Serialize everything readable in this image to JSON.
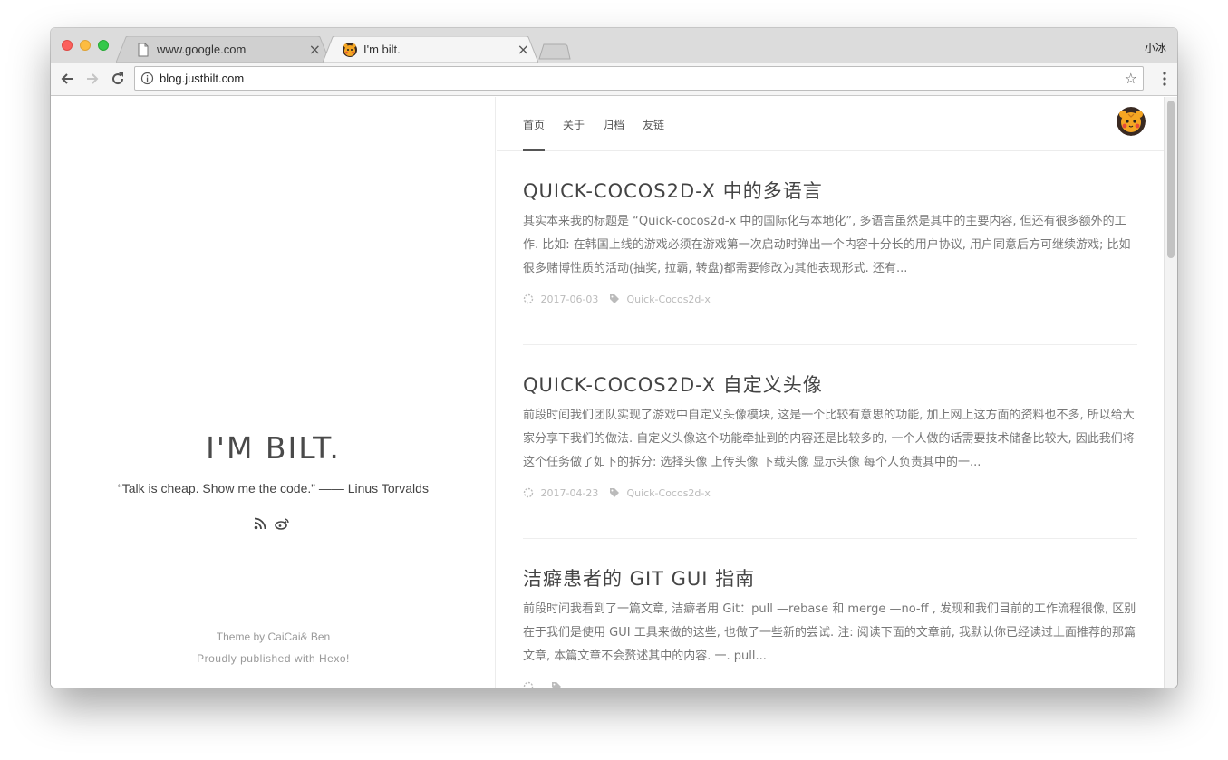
{
  "browser": {
    "tabs": [
      {
        "title": "www.google.com",
        "favicon": "page-icon",
        "active": false
      },
      {
        "title": "I'm bilt.",
        "favicon": "tiger-favicon",
        "active": true
      }
    ],
    "close_glyph": "×",
    "profile_name": "小冰",
    "url": "blog.justbilt.com",
    "star_glyph": "☆"
  },
  "sidebar": {
    "title": "I'M BILT.",
    "quote": "“Talk is cheap. Show me the code.” —— Linus Torvalds",
    "social_icons": [
      "rss-icon",
      "weibo-icon"
    ],
    "footer": {
      "theme_prefix": "Theme by ",
      "author1": "CaiCai",
      "amp": "& ",
      "author2": "Ben",
      "published_prefix": "Proudly published with ",
      "hexo": "Hexo",
      "suffix": "!"
    }
  },
  "nav": {
    "items": [
      "首页",
      "关于",
      "归档",
      "友链"
    ],
    "active_index": 0
  },
  "posts": [
    {
      "title": "QUICK-COCOS2D-X 中的多语言",
      "excerpt": "其实本来我的标题是 “Quick-cocos2d-x 中的国际化与本地化”, 多语言虽然是其中的主要内容, 但还有很多额外的工作. 比如: 在韩国上线的游戏必须在游戏第一次启动时弹出一个内容十分长的用户协议, 用户同意后方可继续游戏; 比如很多赌博性质的活动(抽奖, 拉霸, 转盘)都需要修改为其他表现形式. 还有...",
      "date": "2017-06-03",
      "tag": "Quick-Cocos2d-x"
    },
    {
      "title": "QUICK-COCOS2D-X 自定义头像",
      "excerpt": "前段时间我们团队实现了游戏中自定义头像模块, 这是一个比较有意思的功能, 加上网上这方面的资料也不多, 所以给大家分享下我们的做法. 自定义头像这个功能牵扯到的内容还是比较多的, 一个人做的话需要技术储备比较大, 因此我们将这个任务做了如下的拆分: 选择头像 上传头像 下载头像 显示头像 每个人负责其中的一...",
      "date": "2017-04-23",
      "tag": "Quick-Cocos2d-x"
    },
    {
      "title": "洁癖患者的 GIT GUI 指南",
      "excerpt": "前段时间我看到了一篇文章, 洁癖者用 Git：pull —rebase 和 merge —no-ff , 发现和我们目前的工作流程很像, 区别在于我们是使用 GUI 工具来做的这些, 也做了一些新的尝试. 注: 阅读下面的文章前, 我默认你已经读过上面推荐的那篇文章, 本篇文章不会赘述其中的内容. 一. pull...",
      "date": "",
      "tag": ""
    }
  ],
  "colors": {
    "tabstrip": "#dcdcdc",
    "toolbar": "#f5f5f5",
    "text": "#444444",
    "muted": "#bbbbbb"
  }
}
